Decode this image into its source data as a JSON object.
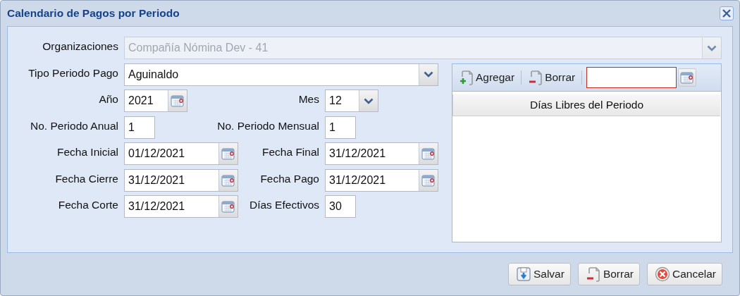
{
  "window": {
    "title": "Calendario de Pagos por Periodo"
  },
  "form": {
    "fields": [
      {
        "label": "Organizaciones",
        "value": "Compañía Nómina Dev - 41",
        "kind": "combo",
        "disabled": true
      },
      {
        "label": "Tipo Periodo Pago",
        "value": "Aguinaldo",
        "kind": "combo",
        "disabled": false
      },
      {
        "label": "Año",
        "value": "2021",
        "kind": "year",
        "disabled": false
      },
      {
        "label": "Mes",
        "value": "12",
        "kind": "month",
        "disabled": false
      },
      {
        "label": "No. Periodo Anual",
        "value": "1",
        "kind": "number",
        "disabled": false
      },
      {
        "label": "No. Periodo Mensual",
        "value": "1",
        "kind": "number",
        "disabled": false
      },
      {
        "label": "Fecha Inicial",
        "value": "01/12/2021",
        "kind": "date",
        "disabled": false
      },
      {
        "label": "Fecha Final",
        "value": "31/12/2021",
        "kind": "date",
        "disabled": false
      },
      {
        "label": "Fecha Cierre",
        "value": "31/12/2021",
        "kind": "date",
        "disabled": false
      },
      {
        "label": "Fecha Pago",
        "value": "31/12/2021",
        "kind": "date",
        "disabled": false
      },
      {
        "label": "Fecha Corte",
        "value": "31/12/2021",
        "kind": "date",
        "disabled": false
      },
      {
        "label": "Días Efectivos",
        "value": "30",
        "kind": "number",
        "disabled": false
      }
    ]
  },
  "free_days": {
    "toolbar": [
      {
        "label": "Agregar",
        "kind": "add"
      },
      {
        "label": "Borrar",
        "kind": "delete"
      }
    ],
    "date_field": {
      "invalid": true
    },
    "columns": [
      "Días Libres del Periodo"
    ]
  },
  "buttons": [
    {
      "label": "Salvar",
      "kind": "save"
    },
    {
      "label": "Borrar",
      "kind": "delete"
    },
    {
      "label": "Cancelar",
      "kind": "cancel"
    }
  ]
}
